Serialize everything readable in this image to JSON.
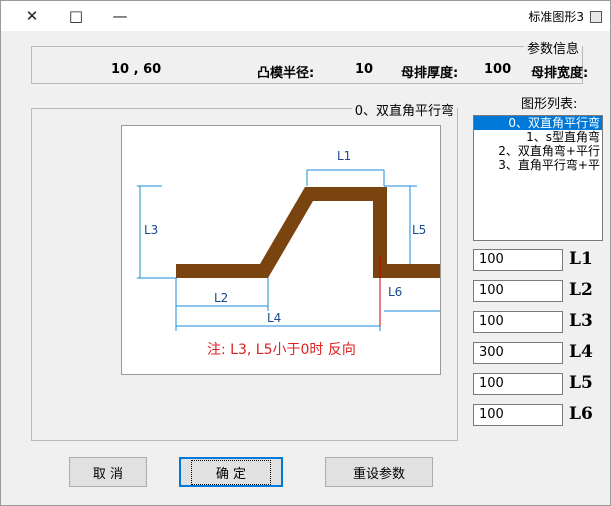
{
  "window": {
    "title": "标准图形3",
    "close_glyph": "✕",
    "max_glyph": "□",
    "min_glyph": "—"
  },
  "params": {
    "title": "参数信息",
    "width_label": "母排宽度:",
    "width_value": "100",
    "thickness_label": "母排厚度:",
    "thickness_value": "10",
    "radius_label": "凸模半径:",
    "radius_value": "10 , 60"
  },
  "shape_list": {
    "label": "图形列表:",
    "items": [
      "0、双直角平行弯",
      "1、s型直角弯",
      "2、双直角弯+平行",
      "3、直角平行弯+平"
    ],
    "selected_index": 0
  },
  "preview": {
    "title": "0、双直角平行弯",
    "dim_labels": [
      "L1",
      "L2",
      "L3",
      "L4",
      "L5",
      "L6"
    ],
    "note": "注: L3, L5小于0时 反向",
    "colors": {
      "bar": "#7a4410",
      "dim": "#1a8cd8",
      "note": "#e02020",
      "mark": "#cc0000"
    }
  },
  "fields": [
    {
      "label": "L1",
      "value": "100"
    },
    {
      "label": "L2",
      "value": "100"
    },
    {
      "label": "L3",
      "value": "100"
    },
    {
      "label": "L4",
      "value": "300"
    },
    {
      "label": "L5",
      "value": "100"
    },
    {
      "label": "L6",
      "value": "100"
    }
  ],
  "buttons": {
    "cancel": "取 消",
    "ok": "确 定",
    "reset": "重设参数"
  }
}
